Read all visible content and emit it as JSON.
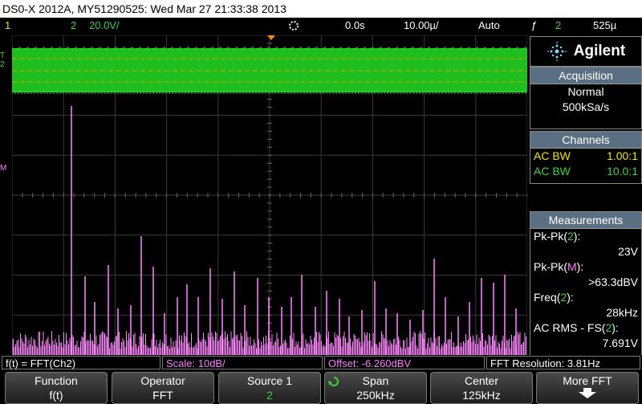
{
  "title": "DS0-X 2012A, MY51290525: Wed Mar 27 21:33:38 2013",
  "status": {
    "ch1_num": "1",
    "ch2_num": "2",
    "ch2_scale": "20.0V/",
    "trigger_icon": "trigger-icon",
    "delay": "0.0s",
    "timebase": "10.00µ/",
    "mode": "Auto",
    "trig_slope": "ƒ",
    "trig_src": "2",
    "trig_level": "525µ"
  },
  "brand": {
    "name": "Agilent"
  },
  "acquisition": {
    "header": "Acquisition",
    "mode": "Normal",
    "rate": "500kSa/s"
  },
  "channels": {
    "header": "Channels",
    "rows": [
      {
        "label": "AC BW",
        "probe": "1.00:1",
        "color": "#f2e600"
      },
      {
        "label": "AC BW",
        "probe": "10.0:1",
        "color": "#3cd23c"
      }
    ]
  },
  "measurements": {
    "header": "Measurements",
    "items": [
      {
        "name": "Pk-Pk(",
        "src": "2",
        "close": "):",
        "value": "23V"
      },
      {
        "name": "Pk-Pk(",
        "src": "M",
        "close": "):",
        "value": ">63.3dBV"
      },
      {
        "name": "Freq(",
        "src": "2",
        "close": "):",
        "value": "28kHz"
      },
      {
        "name": "AC RMS - FS(",
        "src": "2",
        "close": "):",
        "value": "7.691V"
      }
    ]
  },
  "info": {
    "fft": "f(t) = FFT(Ch2)",
    "scale": "Scale: 10dB/",
    "offset": "Offset: -6.260dBV",
    "resolution": "FFT Resolution: 3.81Hz"
  },
  "softkeys": [
    {
      "title": "Function",
      "value": "f(t)"
    },
    {
      "title": "Operator",
      "value": "FFT"
    },
    {
      "title": "Source 1",
      "value": "2"
    },
    {
      "title": "Span",
      "value": "250kHz"
    },
    {
      "title": "Center",
      "value": "125kHz"
    },
    {
      "title": "More FFT",
      "value": ""
    }
  ],
  "markers": {
    "ch2": "2",
    "ch2_trig": "T",
    "math": "M"
  },
  "colors": {
    "ch1": "#f2e600",
    "ch2": "#1ebe1e",
    "math": "#ff88ff",
    "grid": "#3a3a3a",
    "panel_header": "#5b6f83"
  }
}
